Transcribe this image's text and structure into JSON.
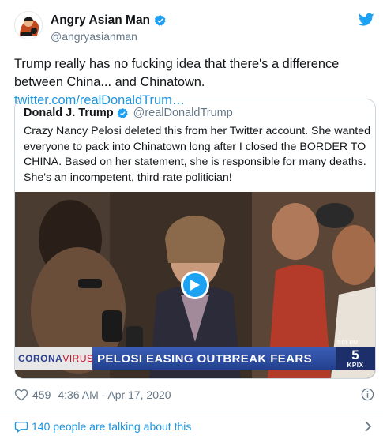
{
  "author": {
    "display_name": "Angry Asian Man",
    "handle": "@angryasianman",
    "verified": true
  },
  "tweet": {
    "text": "Trump really has no fucking idea that there's a difference between China... and Chinatown. ",
    "link_text": "twitter.com/realDonaldTrum…"
  },
  "quoted_tweet": {
    "display_name": "Donald J. Trump",
    "handle": "@realDonaldTrump",
    "verified": true,
    "text": "Crazy Nancy Pelosi deleted this from her Twitter account. She wanted everyone to pack into Chinatown long after I closed the BORDER TO CHINA. Based on her statement, she is responsible for many deaths. She's an incompetent, third-rate politician!"
  },
  "video": {
    "banner_tag_part1": "CORONA",
    "banner_tag_part2": "VIRUS",
    "headline": "PELOSI EASING OUTBREAK FEARS",
    "station_number": "5",
    "station_call": "KPIX",
    "clock": "5:01 PM"
  },
  "meta": {
    "likes": "459",
    "timestamp": "4:36 AM - Apr 17, 2020"
  },
  "footer": {
    "talking_text": "140 people are talking about this"
  },
  "colors": {
    "verified_blue": "#1da1f2",
    "link_blue": "#1b95e0",
    "text_primary": "#14171a",
    "text_secondary": "#657786",
    "border": "#ccd6dd"
  },
  "icons": [
    "verified-badge-icon",
    "twitter-bird-icon",
    "play-icon",
    "heart-icon",
    "info-icon",
    "speech-bubble-icon",
    "chevron-right-icon"
  ]
}
